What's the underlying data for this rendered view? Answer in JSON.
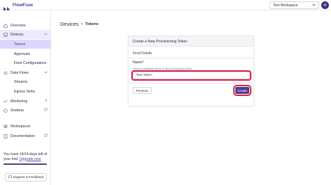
{
  "header": {
    "logo_text": "FlowFuse",
    "workspace_select": "Test Workspace",
    "avatar_initial": "M"
  },
  "sidebar": {
    "items": [
      {
        "label": "Overview"
      },
      {
        "label": "Devices"
      },
      {
        "label": "Tokens"
      },
      {
        "label": "Approvals"
      },
      {
        "label": "Fleet Configurations"
      },
      {
        "label": "Data Flows"
      },
      {
        "label": "Streams"
      },
      {
        "label": "Egress Sinks"
      },
      {
        "label": "Monitoring"
      },
      {
        "label": "Grafana"
      },
      {
        "label": "Workspaces"
      },
      {
        "label": "Documentation"
      }
    ],
    "trial_text": "You have 14/14 days left of your trial.",
    "trial_link": "Upgrade now",
    "trial_progress": 1.0,
    "support_label": "Support & Feedback"
  },
  "main": {
    "breadcrumb_root": "Devices",
    "breadcrumb_sep": "»",
    "breadcrumb_current": "Tokens",
    "card": {
      "title": "Create a New Provisioning Token",
      "section": "Final Details",
      "field_label": "Name*",
      "field_help": "Human-readable name of the provisioning token",
      "field_value": "Test Token",
      "previous_label": "Previous",
      "create_label": "Create"
    }
  },
  "colors": {
    "accent": "#4c3f91",
    "highlight": "#e11d48",
    "active_bg": "#ede9fe"
  }
}
